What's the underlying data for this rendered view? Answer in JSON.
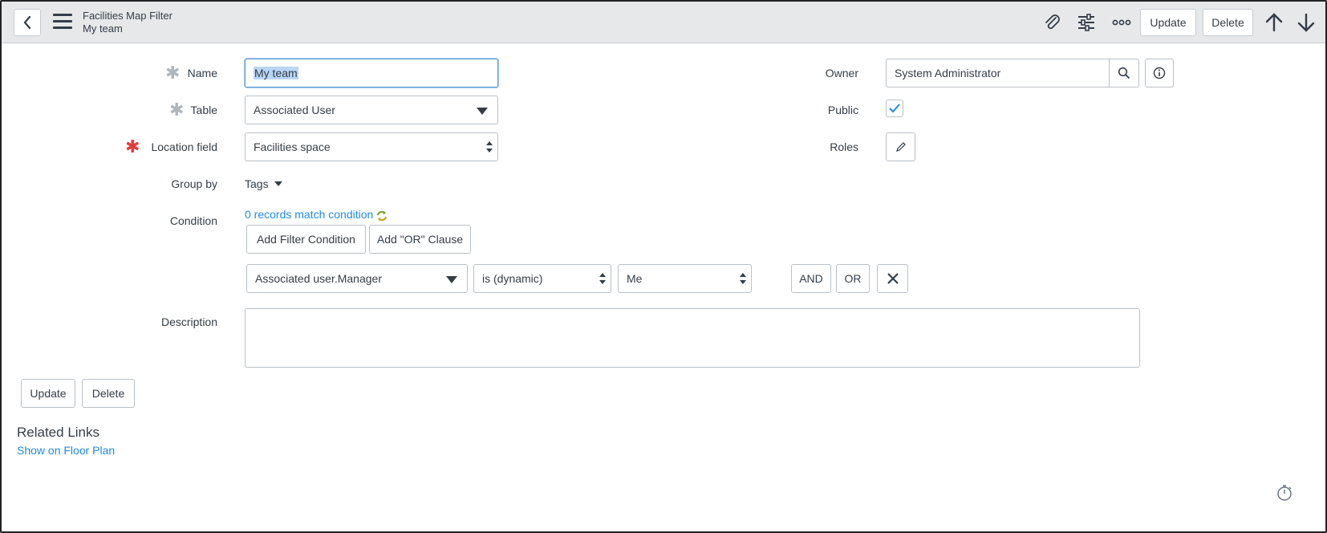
{
  "header": {
    "title": "Facilities Map Filter",
    "subtitle": "My team",
    "update_label": "Update",
    "delete_label": "Delete"
  },
  "form": {
    "name": {
      "label": "Name",
      "value": "My team"
    },
    "table": {
      "label": "Table",
      "value": "Associated User"
    },
    "location_field": {
      "label": "Location field",
      "value": "Facilities space"
    },
    "group_by": {
      "label": "Group by",
      "value": "Tags"
    },
    "condition": {
      "label": "Condition",
      "match_text": "0 records match condition",
      "add_filter_label": "Add Filter Condition",
      "add_or_label": "Add \"OR\" Clause",
      "row": {
        "field": "Associated user.Manager",
        "operator": "is (dynamic)",
        "value": "Me",
        "and_label": "AND",
        "or_label": "OR"
      }
    },
    "description": {
      "label": "Description",
      "value": ""
    },
    "owner": {
      "label": "Owner",
      "value": "System Administrator"
    },
    "public": {
      "label": "Public",
      "checked": true
    },
    "roles": {
      "label": "Roles"
    }
  },
  "footer": {
    "update_label": "Update",
    "delete_label": "Delete"
  },
  "related_links": {
    "heading": "Related Links",
    "show_on_floor_plan": "Show on Floor Plan"
  },
  "colors": {
    "link": "#1f8ae8",
    "required": "#e8383d",
    "header_bg": "#e6e8ea",
    "selection": "#b9d6f5"
  }
}
